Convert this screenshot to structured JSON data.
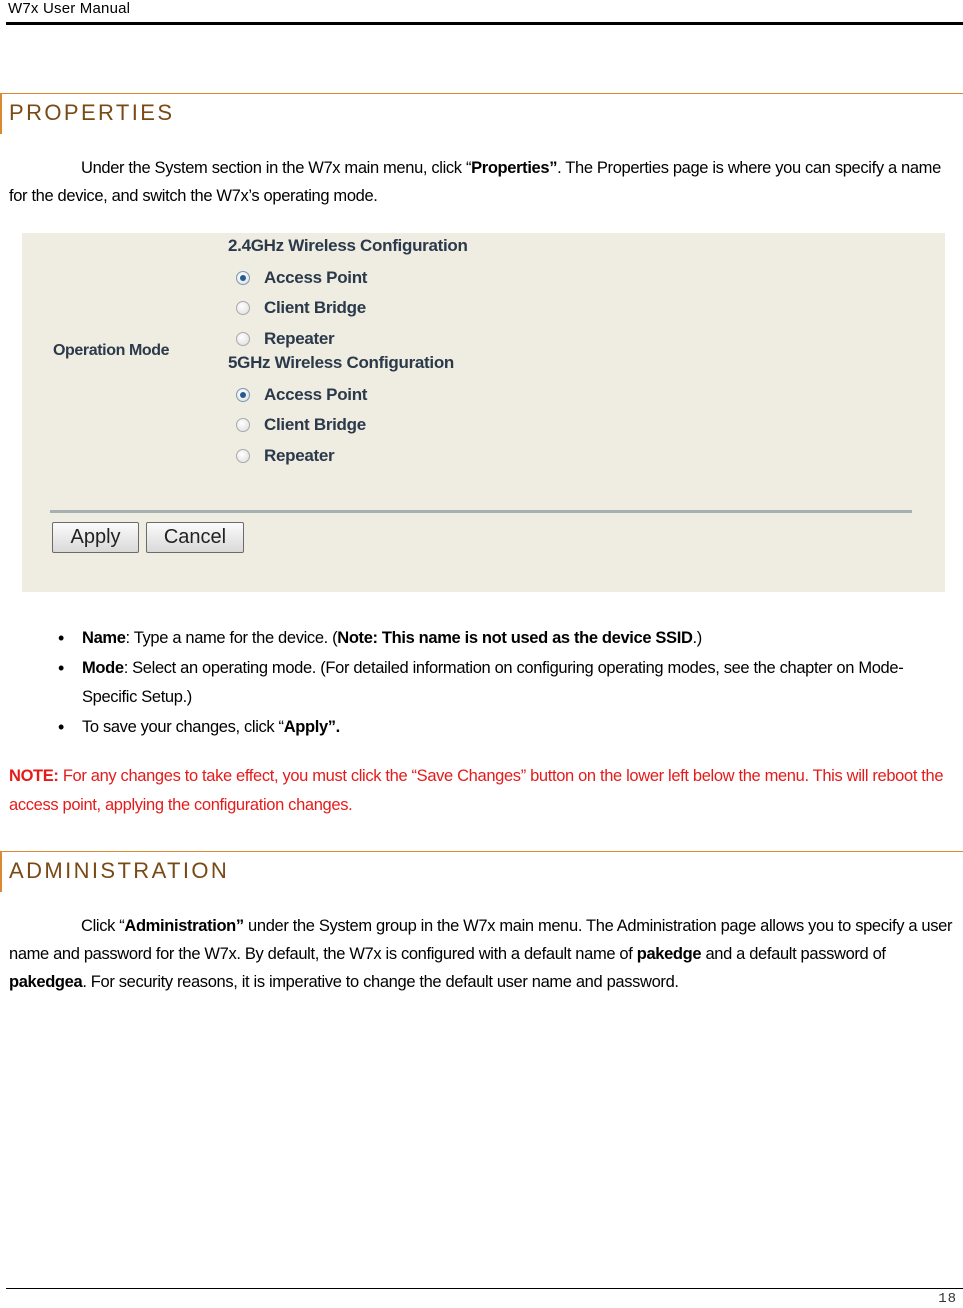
{
  "header": {
    "title": "W7x User Manual"
  },
  "properties": {
    "heading": "PROPERTIES",
    "intro": {
      "part1": "Under the System section in the W7x main menu, click “",
      "bold": "Properties”",
      "part2": ". The Properties page is where you can specify a name for the device, and switch the W7x’s operating mode."
    },
    "screenshot": {
      "operation_mode_label": "Operation Mode",
      "groups": [
        {
          "heading": "2.4GHz Wireless Configuration",
          "options": [
            {
              "label": "Access Point",
              "checked": true
            },
            {
              "label": "Client Bridge",
              "checked": false
            },
            {
              "label": "Repeater",
              "checked": false
            }
          ]
        },
        {
          "heading": "5GHz Wireless Configuration",
          "options": [
            {
              "label": "Access Point",
              "checked": true
            },
            {
              "label": "Client Bridge",
              "checked": false
            },
            {
              "label": "Repeater",
              "checked": false
            }
          ]
        }
      ],
      "apply_label": "Apply",
      "cancel_label": "Cancel"
    },
    "bullets": [
      {
        "bold": "Name",
        "text1": ": Type a name for the device. (",
        "bold2": "Note: This name is not used as the device SSID",
        "text2": ".)"
      },
      {
        "bold": "Mode",
        "text1": ": Select an operating mode. (For detailed information on configuring operating modes, see the chapter on Mode-Specific Setup.)"
      },
      {
        "text0": "To save your changes, click “",
        "bold": "Apply”."
      }
    ],
    "note": {
      "bold": "NOTE:",
      "text": " For any changes to take effect, you must click the “Save Changes” button on the lower left below the menu. This will reboot the access point, applying the configuration changes."
    }
  },
  "administration": {
    "heading": "ADMINISTRATION",
    "intro": {
      "part1": "Click “",
      "bold1": "Administration”",
      "part2": " under the System group in the W7x main menu. The Administration page allows you to specify a user name and password for the W7x. By default, the W7x is configured with a default name of ",
      "bold2": "pakedge",
      "part3": " and a default password of ",
      "bold3": "pakedgea",
      "part4": ". For security reasons, it is imperative to change the default user name and password."
    }
  },
  "footer": {
    "page_number": "18"
  },
  "colors": {
    "heading_rule": "#d9892f",
    "heading_text": "#7a4a16",
    "note_red": "#e51b1b",
    "screenshot_bg": "#efece2"
  }
}
